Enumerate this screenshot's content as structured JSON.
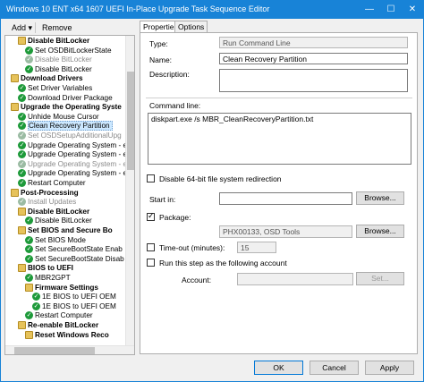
{
  "window": {
    "title": "Windows 10 ENT x64 1607 UEFI In-Place Upgrade Task Sequence Editor",
    "controls": {
      "minimize": "—",
      "maximize": "☐",
      "close": "✕"
    }
  },
  "toolbar": {
    "add": "Add",
    "add_arrow": "▾",
    "remove": "Remove"
  },
  "tree": [
    {
      "label": "Disable BitLocker",
      "icon": "folder",
      "level": 2,
      "bold": true
    },
    {
      "label": "Set OSDBitLockerState",
      "icon": "check",
      "level": 3
    },
    {
      "label": "Disable BitLocker",
      "icon": "check",
      "level": 3,
      "grey": true
    },
    {
      "label": "Disable BitLocker",
      "icon": "check",
      "level": 3
    },
    {
      "label": "Download Drivers",
      "icon": "folder",
      "level": 1,
      "bold": true
    },
    {
      "label": "Set Driver Variables",
      "icon": "check",
      "level": 2
    },
    {
      "label": "Download Driver Package",
      "icon": "check",
      "level": 2
    },
    {
      "label": "Upgrade the Operating Syste",
      "icon": "folder",
      "level": 1,
      "bold": true
    },
    {
      "label": "Unhide Mouse Cursor",
      "icon": "check",
      "level": 2
    },
    {
      "label": "Clean Recovery Partition",
      "icon": "check",
      "level": 2,
      "selected": true
    },
    {
      "label": "Set OSDSetupAdditionalUpg",
      "icon": "check",
      "level": 2,
      "grey": true
    },
    {
      "label": "Upgrade Operating System - er",
      "icon": "check",
      "level": 2
    },
    {
      "label": "Upgrade Operating System - er",
      "icon": "check",
      "level": 2
    },
    {
      "label": "Upgrade Operating System - er",
      "icon": "check",
      "level": 2,
      "grey": true
    },
    {
      "label": "Upgrade Operating System - er",
      "icon": "check",
      "level": 2
    },
    {
      "label": "Restart Computer",
      "icon": "check",
      "level": 2
    },
    {
      "label": "Post-Processing",
      "icon": "folder",
      "level": 1,
      "bold": true
    },
    {
      "label": "Install Updates",
      "icon": "check",
      "level": 2,
      "grey": true
    },
    {
      "label": "Disable BitLocker",
      "icon": "folder",
      "level": 2,
      "bold": true
    },
    {
      "label": "Disable BitLocker",
      "icon": "check",
      "level": 3
    },
    {
      "label": "Set BIOS and Secure Bo",
      "icon": "folder",
      "level": 2,
      "bold": true
    },
    {
      "label": "Set BIOS Mode",
      "icon": "check",
      "level": 3
    },
    {
      "label": "Set SecureBootState Enab",
      "icon": "check",
      "level": 3
    },
    {
      "label": "Set SecureBootState Disab",
      "icon": "check",
      "level": 3
    },
    {
      "label": "BIOS to UEFI",
      "icon": "folder",
      "level": 2,
      "bold": true
    },
    {
      "label": "MBR2GPT",
      "icon": "check",
      "level": 3
    },
    {
      "label": "Firmware Settings",
      "icon": "folder",
      "level": 3,
      "bold": true
    },
    {
      "label": "1E BIOS to UEFI OEM",
      "icon": "check",
      "level": 4
    },
    {
      "label": "1E BIOS to UEFI OEM",
      "icon": "check",
      "level": 4
    },
    {
      "label": "Restart Computer",
      "icon": "check",
      "level": 3
    },
    {
      "label": "Re-enable BitLocker",
      "icon": "folder",
      "level": 2,
      "bold": true
    },
    {
      "label": "Reset Windows Reco",
      "icon": "folder",
      "level": 3,
      "bold": true
    }
  ],
  "tabs": {
    "properties": "Properties",
    "options": "Options"
  },
  "properties": {
    "type_label": "Type:",
    "type_value": "Run Command Line",
    "name_label": "Name:",
    "name_value": "Clean Recovery Partition",
    "description_label": "Description:",
    "description_value": "",
    "command_line_label": "Command line:",
    "command_line_value": "diskpart.exe /s MBR_CleanRecoveryPartition.txt",
    "disable_64bit_label": "Disable 64-bit file system redirection",
    "disable_64bit_checked": false,
    "start_in_label": "Start in:",
    "start_in_value": "",
    "browse_label": "Browse...",
    "package_label": "Package:",
    "package_checked": true,
    "package_value": "PHX00133, OSD Tools",
    "browse2_label": "Browse...",
    "timeout_label": "Time-out (minutes):",
    "timeout_checked": false,
    "timeout_value": "15",
    "run_as_label": "Run this step as the following account",
    "run_as_checked": false,
    "account_label": "Account:",
    "account_value": "",
    "set_label": "Set..."
  },
  "buttons": {
    "ok": "OK",
    "cancel": "Cancel",
    "apply": "Apply"
  }
}
